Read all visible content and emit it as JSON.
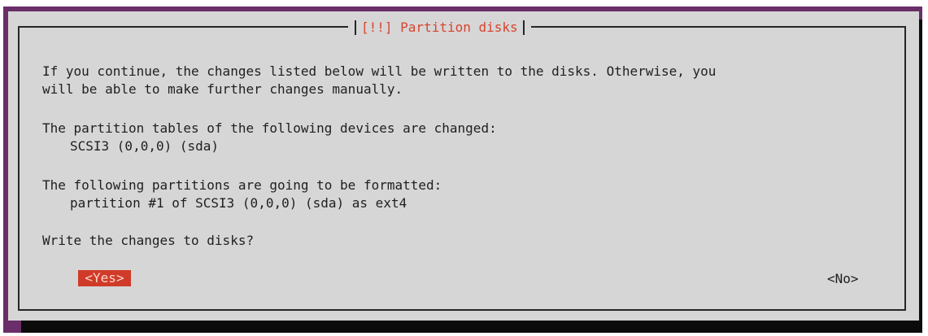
{
  "dialog": {
    "title": "[!!] Partition disks",
    "message_line1": "If you continue, the changes listed below will be written to the disks. Otherwise, you",
    "message_line2": "will be able to make further changes manually.",
    "partition_tables_heading": "The partition tables of the following devices are changed:",
    "partition_tables_device": "SCSI3 (0,0,0) (sda)",
    "formatted_heading": "The following partitions are going to be formatted:",
    "formatted_partition": "partition #1 of SCSI3 (0,0,0) (sda) as ext4",
    "question": "Write the changes to disks?"
  },
  "buttons": {
    "yes": "<Yes>",
    "no": "<No>"
  }
}
